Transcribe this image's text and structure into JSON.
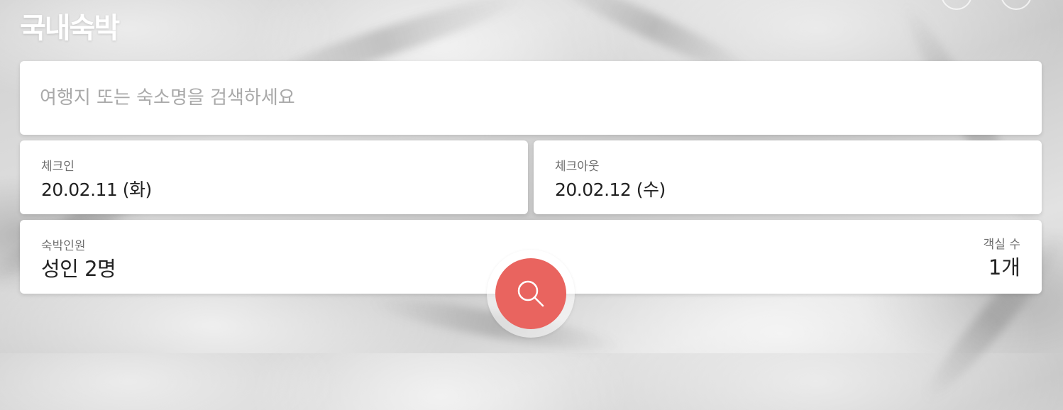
{
  "header": {
    "title": "국내숙박"
  },
  "search": {
    "placeholder": "여행지 또는 숙소명을 검색하세요",
    "value": ""
  },
  "checkin": {
    "label": "체크인",
    "value": "20.02.11 (화)"
  },
  "checkout": {
    "label": "체크아웃",
    "value": "20.02.12 (수)"
  },
  "guests": {
    "label": "숙박인원",
    "value": "성인 2명"
  },
  "rooms": {
    "label": "객실 수",
    "value": "1개"
  },
  "search_button": {
    "icon": "search-icon",
    "color": "#e9645f"
  }
}
